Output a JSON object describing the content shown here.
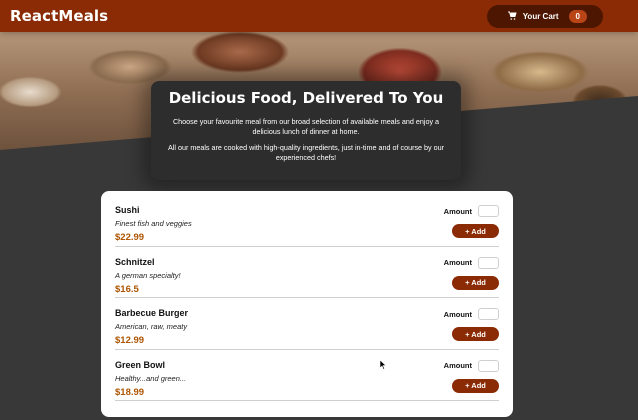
{
  "header": {
    "brand": "ReactMeals",
    "cart": {
      "label": "Your Cart",
      "count": "0",
      "icon": "cart-icon"
    }
  },
  "summary": {
    "title": "Delicious Food, Delivered To You",
    "paragraph_1": "Choose your favourite meal from our broad selection of available meals and enjoy a delicious lunch of dinner at home.",
    "paragraph_2": "All our meals are cooked with high-quality ingredients, just in-time and of course by our experienced chefs!"
  },
  "meals": [
    {
      "name": "Sushi",
      "description": "Finest fish and veggies",
      "price": "$22.99",
      "amount_label": "Amount",
      "amount_value": "",
      "add_label": "+ Add"
    },
    {
      "name": "Schnitzel",
      "description": "A german specialty!",
      "price": "$16.5",
      "amount_label": "Amount",
      "amount_value": "",
      "add_label": "+ Add"
    },
    {
      "name": "Barbecue Burger",
      "description": "American, raw, meaty",
      "price": "$12.99",
      "amount_label": "Amount",
      "amount_value": "",
      "add_label": "+ Add"
    },
    {
      "name": "Green Bowl",
      "description": "Healthy...and green...",
      "price": "$18.99",
      "amount_label": "Amount",
      "amount_value": "",
      "add_label": "+ Add"
    }
  ],
  "colors": {
    "header_bg": "#8a2b06",
    "cart_bg": "#4d1601",
    "badge_bg": "#b94517",
    "price": "#ad5502",
    "page_bg": "#383838"
  }
}
